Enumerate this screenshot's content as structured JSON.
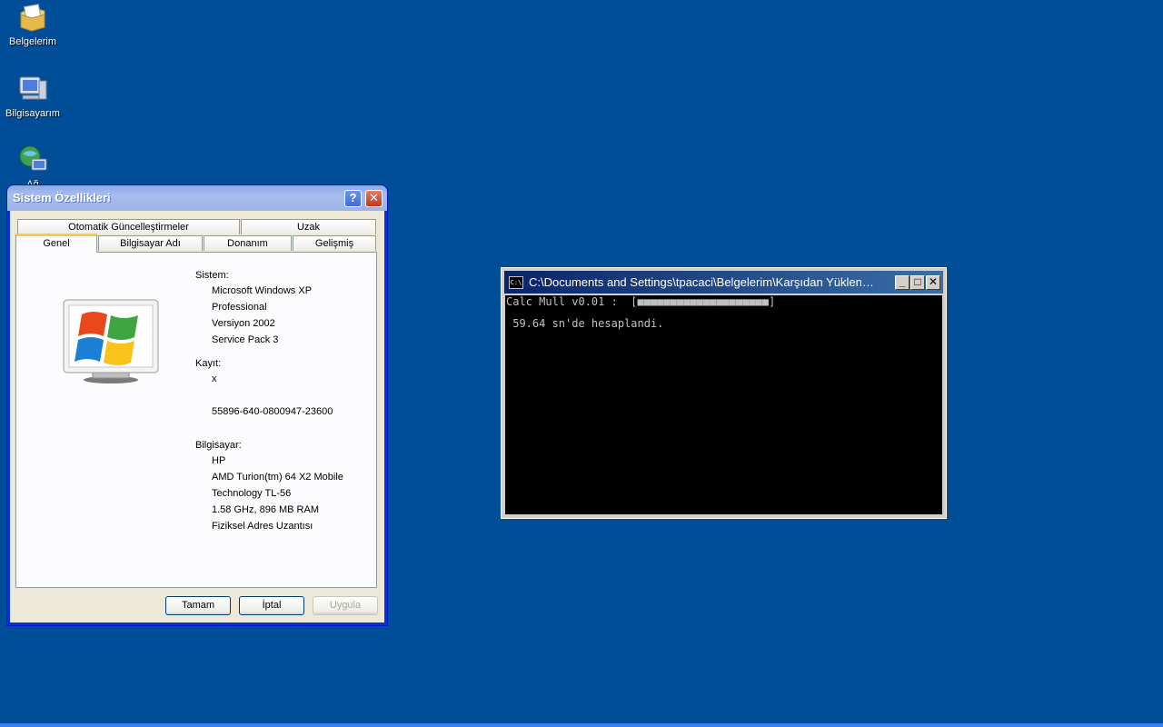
{
  "desktop": {
    "icons": [
      {
        "label": "Belgelerim",
        "icon": "my-documents-icon"
      },
      {
        "label": "Bilgisayarım",
        "icon": "my-computer-icon"
      },
      {
        "label": "Ağ",
        "icon": "network-places-icon"
      }
    ]
  },
  "dialog": {
    "title": "Sistem Özellikleri",
    "help_symbol": "?",
    "close_symbol": "✕",
    "tabs_top": [
      "Otomatik Güncelleştirmeler",
      "Uzak"
    ],
    "tabs_bottom": [
      "Genel",
      "Bilgisayar Adı",
      "Donanım",
      "Gelişmiş"
    ],
    "active_tab": "Genel",
    "system_label": "Sistem:",
    "system_lines": [
      "Microsoft Windows XP",
      "Professional",
      "Versiyon 2002",
      "Service Pack 3"
    ],
    "registered_label": "Kayıt:",
    "registered_lines": [
      "x",
      "",
      "55896-640-0800947-23600"
    ],
    "computer_label": "Bilgisayar:",
    "computer_lines": [
      "HP",
      "AMD Turion(tm) 64 X2 Mobile",
      "Technology TL-56",
      "1.58 GHz, 896 MB RAM",
      "Fiziksel Adres Uzantısı"
    ],
    "buttons": {
      "ok": "Tamam",
      "cancel": "İptal",
      "apply": "Uygula"
    }
  },
  "console": {
    "title": "C:\\Documents and Settings\\tpacaci\\Belgelerim\\Karşıdan Yüklenenler\\calc.exe",
    "icon_text": "C:\\",
    "line1": "Calc Mull v0.01 :  [■■■■■■■■■■■■■■■■■■■■]",
    "line2": " 59.64 sn'de hesaplandi.",
    "btn_min": "_",
    "btn_max": "□",
    "btn_close": "✕"
  }
}
